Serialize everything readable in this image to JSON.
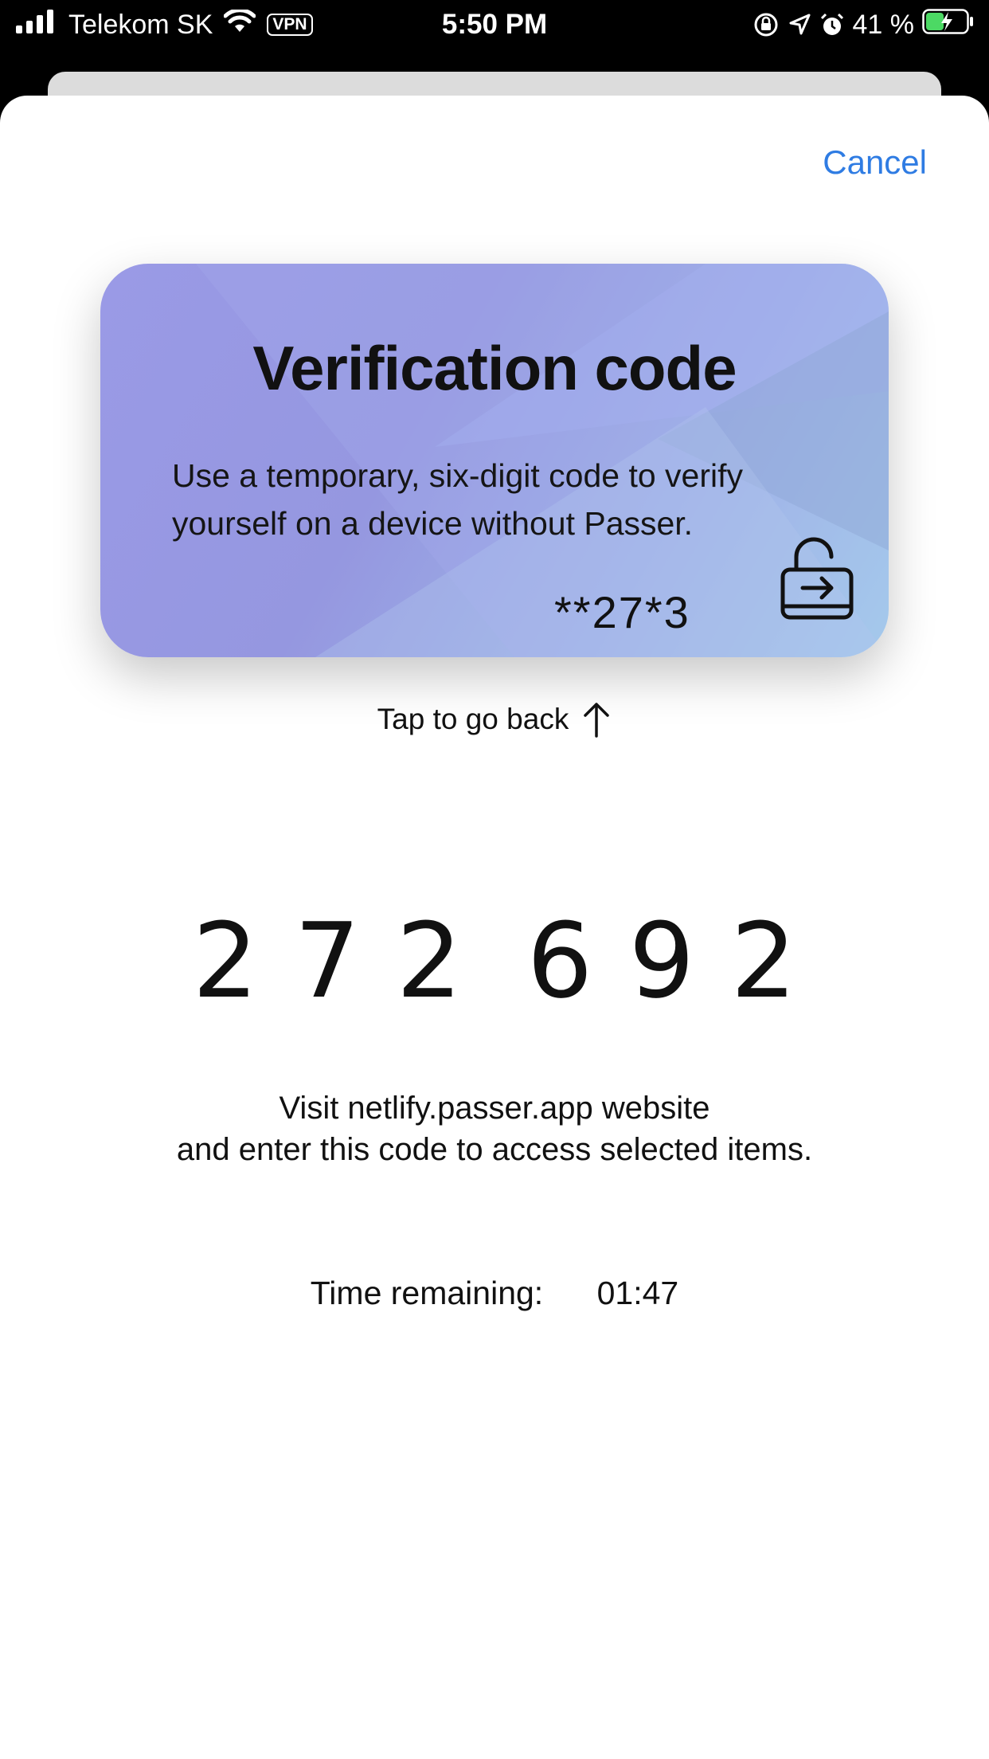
{
  "status_bar": {
    "carrier": "Telekom SK",
    "vpn": "VPN",
    "time": "5:50 PM",
    "battery_percent": "41 %"
  },
  "header": {
    "cancel_label": "Cancel"
  },
  "card": {
    "title": "Verification code",
    "description": "Use a temporary, six-digit code to verify yourself on a device without Passer.",
    "masked_code": "**27*3",
    "icon": "unlock-icon"
  },
  "tap_back_label": "Tap to go back",
  "code": {
    "digits": [
      "2",
      "7",
      "2",
      "6",
      "9",
      "2"
    ]
  },
  "instructions": {
    "line1": "Visit netlify.passer.app website",
    "line2": "and enter this code to access selected items."
  },
  "timer": {
    "label": "Time remaining:",
    "value": "01:47"
  },
  "colors": {
    "accent": "#2f7ce3",
    "battery_fill": "#4cd964"
  }
}
